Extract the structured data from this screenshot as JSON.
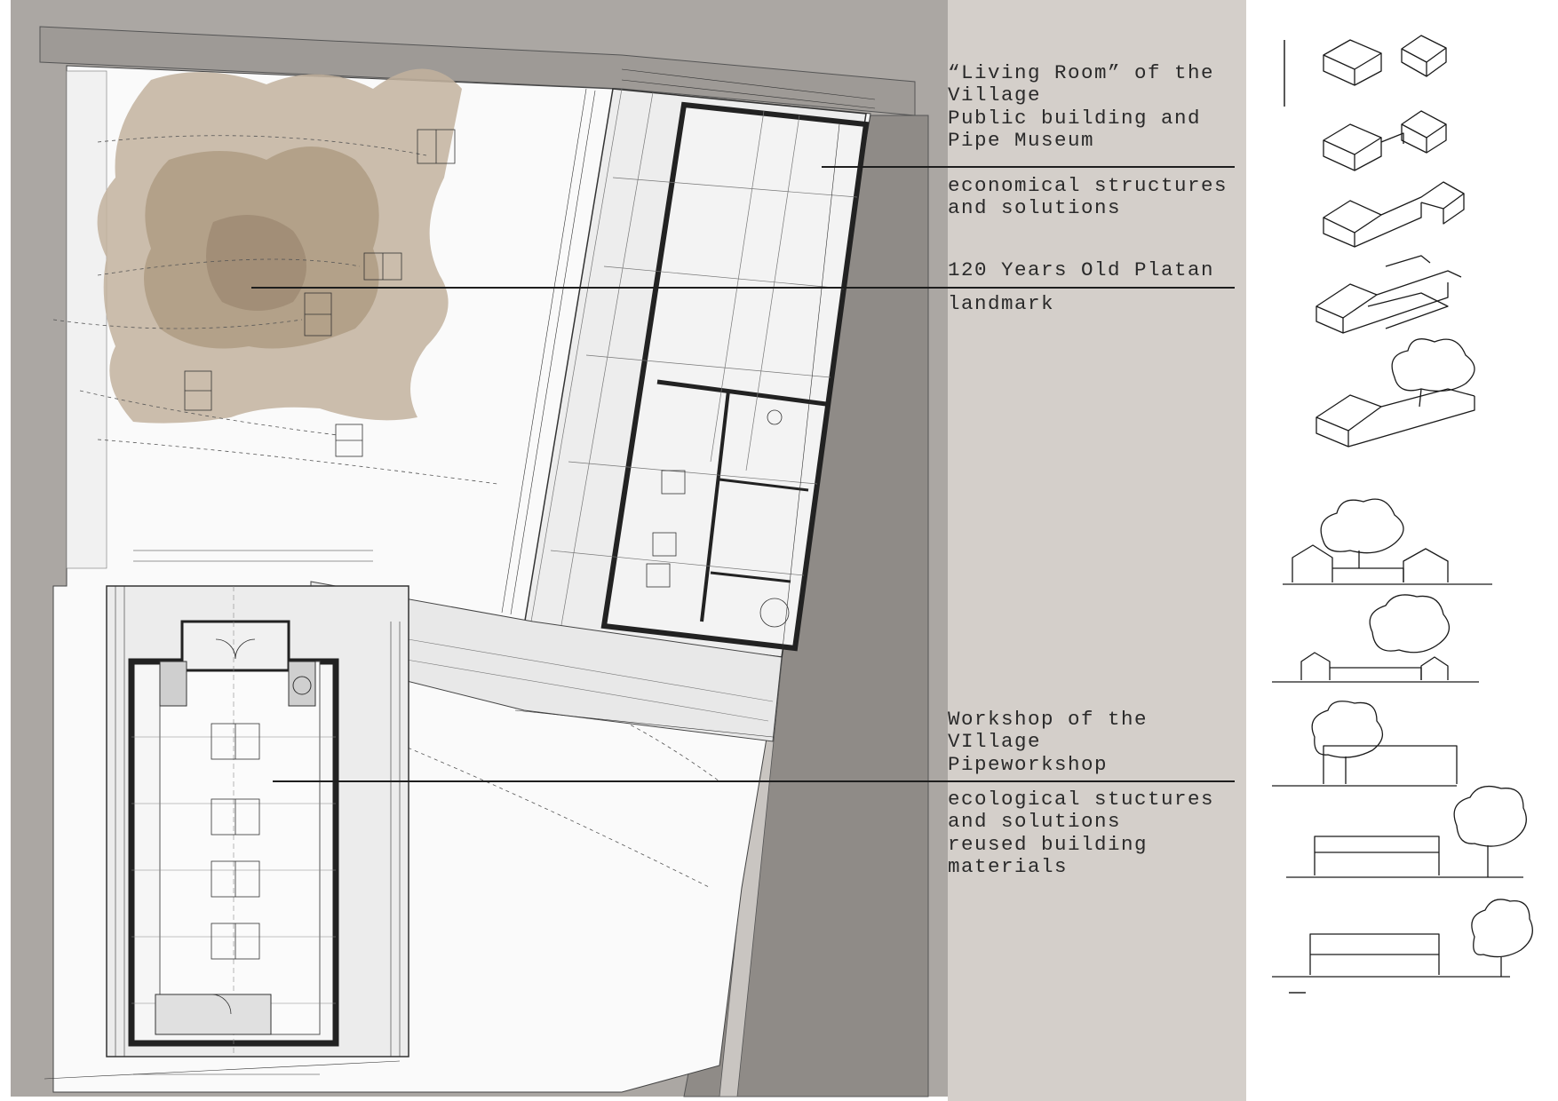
{
  "annotations": {
    "living_room": {
      "title_lines": [
        "“Living Room” of the",
        "Village",
        "Public building and",
        "Pipe Museum"
      ],
      "detail_lines": [
        "economical structures",
        "and solutions"
      ]
    },
    "platan": {
      "title": "120 Years Old Platan",
      "detail": "landmark"
    },
    "workshop": {
      "title_lines": [
        "Workshop of the",
        "VIllage",
        "Pipeworkshop"
      ],
      "detail_lines": [
        "ecological stuctures",
        "and solutions",
        "reused building",
        "materials"
      ]
    }
  },
  "colors": {
    "plan_background": "#aba7a3",
    "text_panel": "#d4cfca",
    "tree_wash": "#b8a58c",
    "linework": "#3a3a3a"
  },
  "sketches": {
    "count": 10,
    "icons": [
      "massing-two-gables-sketch",
      "massing-linked-sketch",
      "massing-l-shape-sketch",
      "massing-courtyard-sketch",
      "massing-with-tree-sketch",
      "elevation-tree-behind-sketch",
      "elevation-tree-right-sketch",
      "elevation-tree-left-sketch",
      "elevation-long-barn-sketch",
      "elevation-barn-open-sketch"
    ]
  }
}
